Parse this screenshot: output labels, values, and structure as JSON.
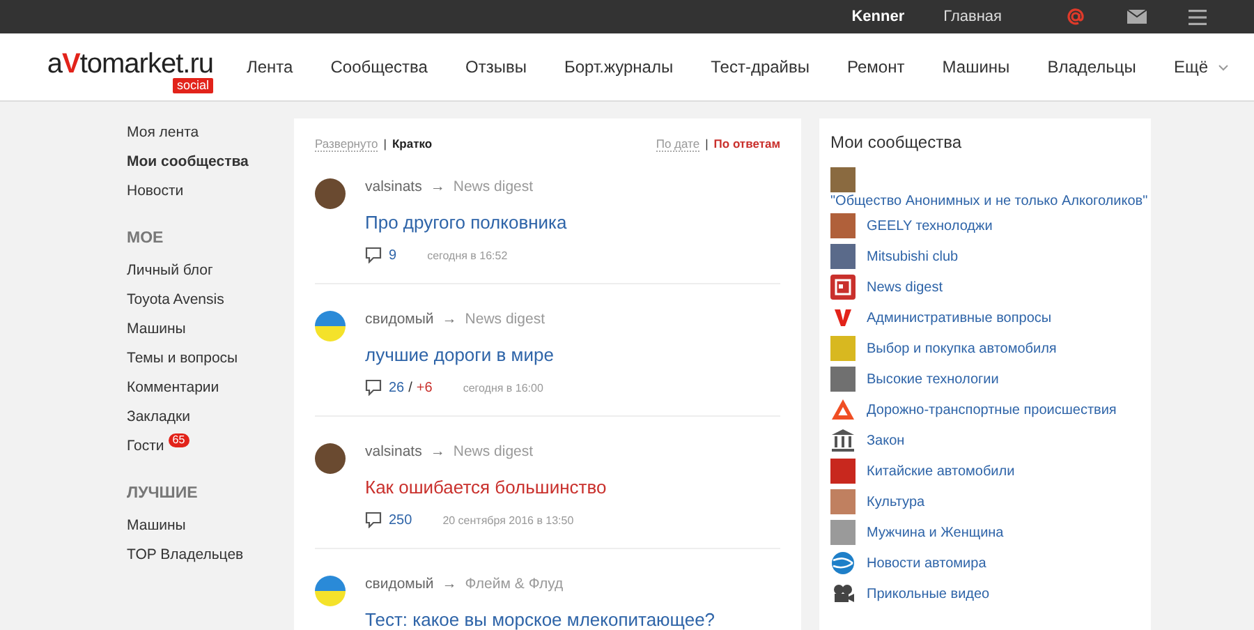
{
  "top_bar": {
    "user": "Kenner",
    "home": "Главная"
  },
  "header": {
    "logo": {
      "pre": "a",
      "mark": "V",
      "post": "tomarket.ru",
      "badge": "social"
    },
    "nav": [
      "Лента",
      "Сообщества",
      "Отзывы",
      "Борт.журналы",
      "Тест-драйвы",
      "Ремонт",
      "Машины",
      "Владельцы",
      "Ещё"
    ]
  },
  "sidebar": {
    "items": [
      {
        "label": "Моя лента",
        "selected": false
      },
      {
        "label": "Мои сообщества",
        "selected": true
      },
      {
        "label": "Новости",
        "selected": false
      }
    ],
    "sections": [
      {
        "title": "МОЕ",
        "items": [
          {
            "label": "Личный блог"
          },
          {
            "label": "Toyota Avensis"
          },
          {
            "label": "Машины"
          },
          {
            "label": "Темы и вопросы"
          },
          {
            "label": "Комментарии"
          },
          {
            "label": "Закладки"
          },
          {
            "label": "Гости",
            "badge": "65"
          }
        ]
      },
      {
        "title": "ЛУЧШИЕ",
        "items": [
          {
            "label": "Машины"
          },
          {
            "label": "TOP Владельцев"
          }
        ]
      }
    ]
  },
  "feed": {
    "view_modes": [
      {
        "label": "Развернуто",
        "selected": false
      },
      {
        "label": "Кратко",
        "selected": true
      }
    ],
    "view_separator": "|",
    "sort_separator": "|",
    "sort_modes": [
      {
        "label": "По дате",
        "selected": false
      },
      {
        "label": "По ответам",
        "selected": true
      }
    ],
    "posts": [
      {
        "kind": "photo",
        "author": "valsinats",
        "arrow": "→",
        "community": "News digest",
        "title": "Про другого полковника",
        "hot": false,
        "comments": "9",
        "time": "сегодня в 16:52"
      },
      {
        "kind": "flag",
        "author": "свидомый",
        "arrow": "→",
        "community": "News digest",
        "title": "лучшие дороги в мире",
        "hot": false,
        "comments": "26",
        "comments_separator": "/",
        "new_comments": "+6",
        "time": "сегодня в 16:00"
      },
      {
        "kind": "photo",
        "author": "valsinats",
        "arrow": "→",
        "community": "News digest",
        "title": "Как ошибается большинство",
        "hot": true,
        "comments": "250",
        "time": "20 сентября 2016 в 13:50"
      },
      {
        "kind": "flag",
        "author": "свидомый",
        "arrow": "→",
        "community": "Флейм & Флуд",
        "title": "Тест: какое вы морское млекопитающее?",
        "hot": false
      }
    ]
  },
  "communities": {
    "title": "Мои сообщества",
    "items": [
      {
        "kind": "photo",
        "color": "#8a6a40",
        "name": "\"Общество Анонимных и не только Алкоголиков\"",
        "wide": true
      },
      {
        "kind": "photo",
        "color": "#b0603a",
        "name": "GEELY технолоджи"
      },
      {
        "kind": "photo",
        "color": "#5a6a8a",
        "name": "Mitsubishi club"
      },
      {
        "kind": "news",
        "name": "News digest"
      },
      {
        "kind": "letter",
        "name": "Административные вопросы"
      },
      {
        "kind": "photo",
        "color": "#d8b820",
        "name": "Выбор и покупка автомобиля"
      },
      {
        "kind": "photo",
        "color": "#707070",
        "name": "Высокие технологии"
      },
      {
        "kind": "warning",
        "name": "Дорожно-транспортные происшествия"
      },
      {
        "kind": "building",
        "name": "Закон"
      },
      {
        "kind": "photo",
        "color": "#c8281e",
        "name": "Китайские автомобили"
      },
      {
        "kind": "photo",
        "color": "#c08060",
        "name": "Культура"
      },
      {
        "kind": "photo",
        "color": "#9a9a9a",
        "name": "Мужчина и Женщина"
      },
      {
        "kind": "globe",
        "name": "Новости автомира"
      },
      {
        "kind": "film",
        "name": "Прикольные видео"
      }
    ]
  }
}
